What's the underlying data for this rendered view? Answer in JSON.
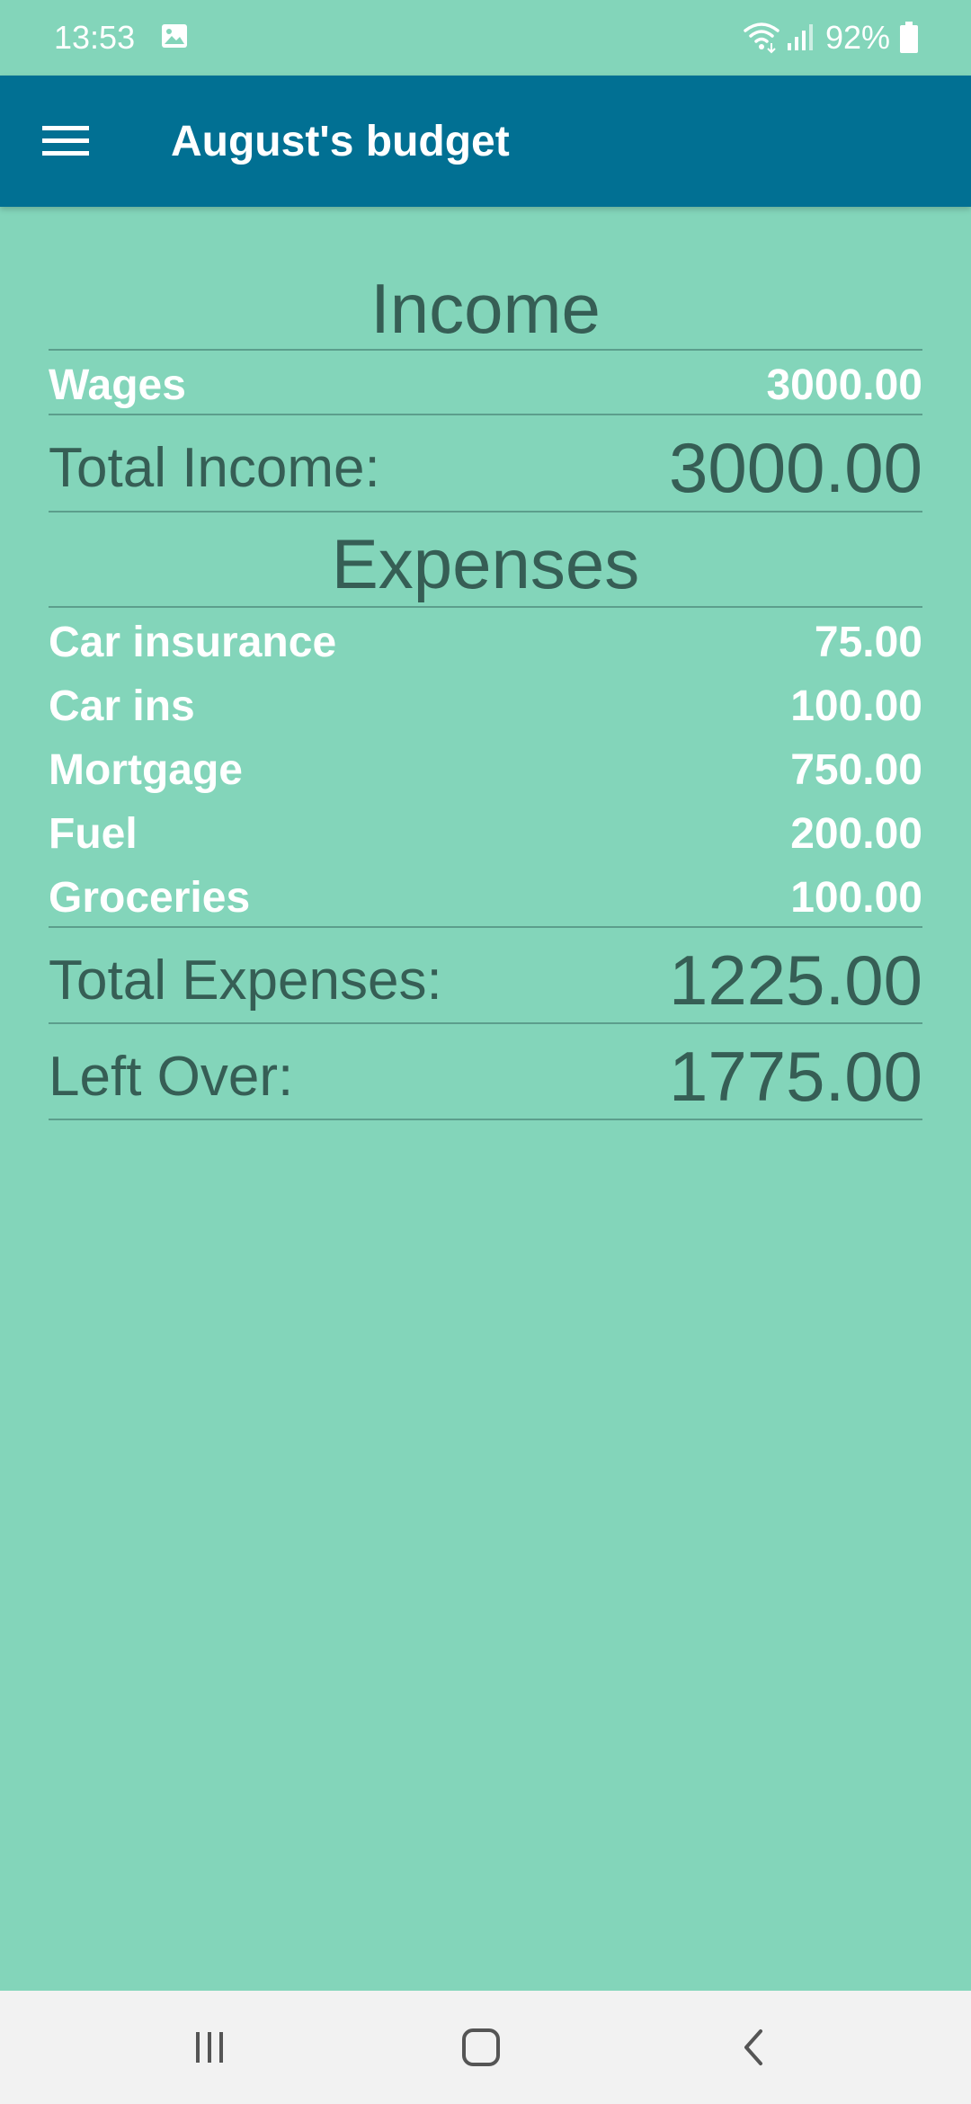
{
  "status_bar": {
    "time": "13:53",
    "battery": "92%",
    "icons": [
      "gallery-icon",
      "wifi-icon",
      "signal-icon",
      "battery-icon"
    ]
  },
  "app_bar": {
    "title": "August's budget",
    "menu_icon": "menu-icon",
    "background": "#017093"
  },
  "income": {
    "heading": "Income",
    "items": [
      {
        "label": "Wages",
        "amount": "3000.00"
      }
    ],
    "total_label": "Total Income:",
    "total_value": "3000.00"
  },
  "expenses": {
    "heading": "Expenses",
    "items": [
      {
        "label": "Car insurance",
        "amount": "75.00"
      },
      {
        "label": "Car ins",
        "amount": "100.00"
      },
      {
        "label": "Mortgage",
        "amount": "750.00"
      },
      {
        "label": "Fuel",
        "amount": "200.00"
      },
      {
        "label": "Groceries",
        "amount": "100.00"
      }
    ],
    "total_label": "Total Expenses:",
    "total_value": "1225.00"
  },
  "left_over": {
    "label": "Left Over:",
    "value": "1775.00"
  },
  "nav_bar": {
    "buttons": [
      "recent-apps-icon",
      "home-icon",
      "back-icon"
    ]
  },
  "colors": {
    "background": "#83d5ba",
    "heading_text": "#365e55",
    "item_text": "#ffffff",
    "nav_background": "#f2f2f2"
  }
}
